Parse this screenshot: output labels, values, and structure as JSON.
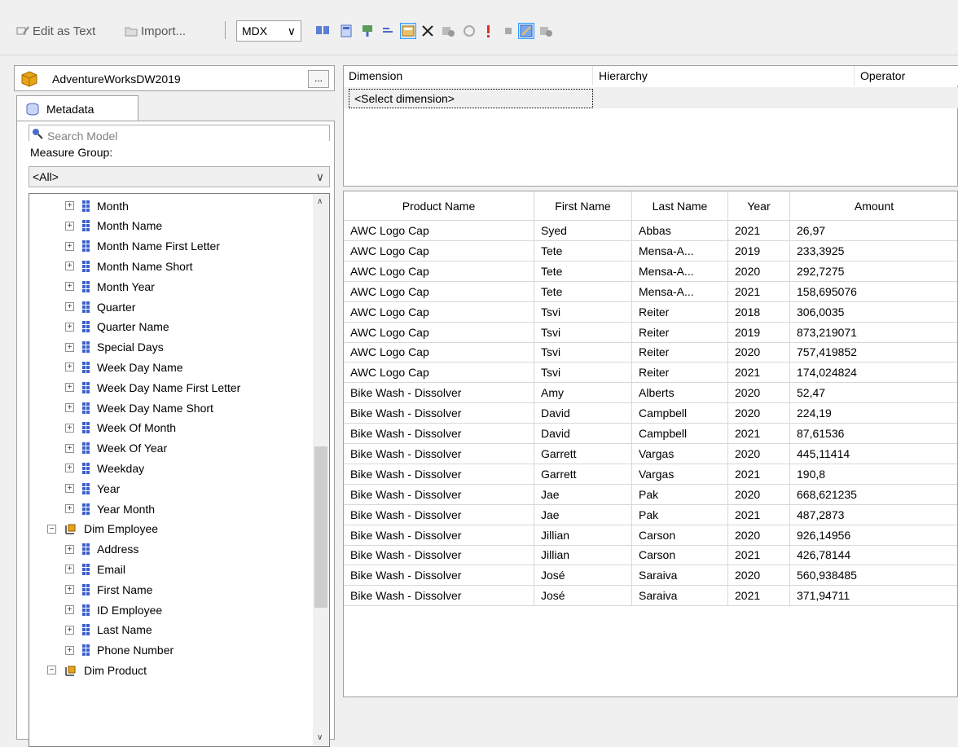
{
  "toolbar": {
    "edit_as_text": "Edit as Text",
    "import": "Import...",
    "query_mode": "MDX"
  },
  "cube": {
    "name": "AdventureWorksDW2019",
    "browse_label": "..."
  },
  "metadata": {
    "tab_label": "Metadata",
    "search_placeholder": "Search Model",
    "measure_group_label": "Measure Group:",
    "measure_group_value": "<All>"
  },
  "tree": {
    "attributes_top": [
      "Month",
      "Month Name",
      "Month Name First Letter",
      "Month Name Short",
      "Month Year",
      "Quarter",
      "Quarter Name",
      "Special Days",
      "Week Day Name",
      "Week Day Name First Letter",
      "Week Day Name Short",
      "Week Of Month",
      "Week Of Year",
      "Weekday",
      "Year",
      "Year Month"
    ],
    "dim_employee": "Dim Employee",
    "attributes_employee": [
      "Address",
      "Email",
      "First Name",
      "ID Employee",
      "Last Name",
      "Phone Number"
    ],
    "dim_product": "Dim Product"
  },
  "filter": {
    "col_dimension": "Dimension",
    "col_hierarchy": "Hierarchy",
    "col_operator": "Operator",
    "select_dimension": "<Select dimension>"
  },
  "grid": {
    "headers": [
      "Product Name",
      "First Name",
      "Last Name",
      "Year",
      "Amount"
    ],
    "rows": [
      [
        "AWC Logo Cap",
        "Syed",
        "Abbas",
        "2021",
        "26,97"
      ],
      [
        "AWC Logo Cap",
        "Tete",
        "Mensa-A...",
        "2019",
        "233,3925"
      ],
      [
        "AWC Logo Cap",
        "Tete",
        "Mensa-A...",
        "2020",
        "292,7275"
      ],
      [
        "AWC Logo Cap",
        "Tete",
        "Mensa-A...",
        "2021",
        "158,695076"
      ],
      [
        "AWC Logo Cap",
        "Tsvi",
        "Reiter",
        "2018",
        "306,0035"
      ],
      [
        "AWC Logo Cap",
        "Tsvi",
        "Reiter",
        "2019",
        "873,219071"
      ],
      [
        "AWC Logo Cap",
        "Tsvi",
        "Reiter",
        "2020",
        "757,419852"
      ],
      [
        "AWC Logo Cap",
        "Tsvi",
        "Reiter",
        "2021",
        "174,024824"
      ],
      [
        "Bike Wash - Dissolver",
        "Amy",
        "Alberts",
        "2020",
        "52,47"
      ],
      [
        "Bike Wash - Dissolver",
        "David",
        "Campbell",
        "2020",
        "224,19"
      ],
      [
        "Bike Wash - Dissolver",
        "David",
        "Campbell",
        "2021",
        "87,61536"
      ],
      [
        "Bike Wash - Dissolver",
        "Garrett",
        "Vargas",
        "2020",
        "445,11414"
      ],
      [
        "Bike Wash - Dissolver",
        "Garrett",
        "Vargas",
        "2021",
        "190,8"
      ],
      [
        "Bike Wash - Dissolver",
        "Jae",
        "Pak",
        "2020",
        "668,621235"
      ],
      [
        "Bike Wash - Dissolver",
        "Jae",
        "Pak",
        "2021",
        "487,2873"
      ],
      [
        "Bike Wash - Dissolver",
        "Jillian",
        "Carson",
        "2020",
        "926,14956"
      ],
      [
        "Bike Wash - Dissolver",
        "Jillian",
        "Carson",
        "2021",
        "426,78144"
      ],
      [
        "Bike Wash - Dissolver",
        "José",
        "Saraiva",
        "2020",
        "560,938485"
      ],
      [
        "Bike Wash - Dissolver",
        "José",
        "Saraiva",
        "2021",
        "371,94711"
      ]
    ]
  },
  "colors": {
    "attribute_icon": "#3a5fcd",
    "active_button": "#cce4f7",
    "dimension_icon": "#e8a317"
  }
}
